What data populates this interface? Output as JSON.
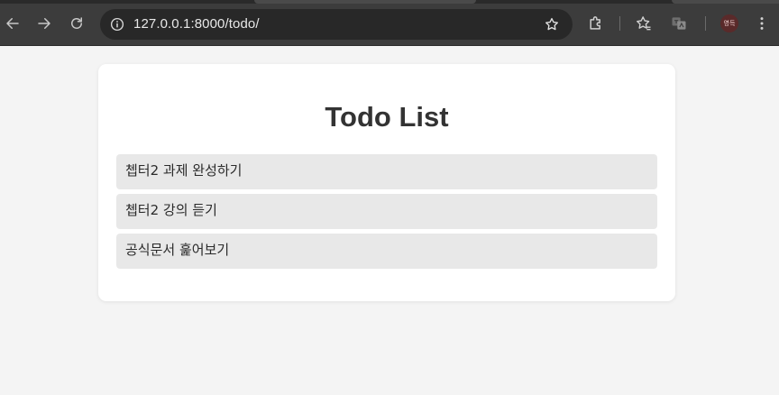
{
  "browser": {
    "url": "127.0.0.1:8000/todo/",
    "profile_label": "영득",
    "icons": {
      "back": "back-arrow-icon",
      "forward": "forward-arrow-icon",
      "reload": "reload-icon",
      "site_info": "info-icon",
      "bookmark": "star-icon",
      "extensions": "puzzle-icon",
      "favorites": "star-list-icon",
      "translate": "translate-icon",
      "menu": "kebab-menu-icon"
    }
  },
  "page": {
    "title": "Todo List",
    "todos": [
      {
        "text": "쳅터2 과제 완성하기"
      },
      {
        "text": "쳅터2 강의 듣기"
      },
      {
        "text": "공식문서 훑어보기"
      }
    ]
  },
  "colors": {
    "page_bg": "#f4f4f4",
    "card_bg": "#ffffff",
    "item_bg": "#e8e8e8",
    "title_text": "#333333",
    "chrome_bg": "#3c3c3c",
    "omnibox_bg": "#282828"
  }
}
